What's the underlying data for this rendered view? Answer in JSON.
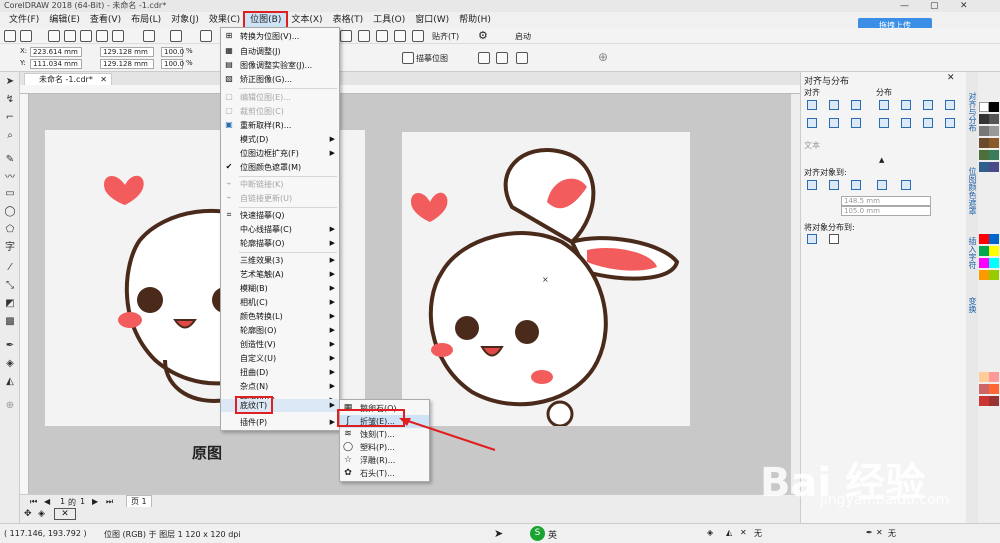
{
  "window": {
    "title": "CorelDRAW 2018 (64-Bit) - 未命名 -1.cdr*"
  },
  "menubar": [
    "文件(F)",
    "编辑(E)",
    "查看(V)",
    "布局(L)",
    "对象(J)",
    "效果(C)",
    "位图(B)",
    "文本(X)",
    "表格(T)",
    "工具(O)",
    "窗口(W)",
    "帮助(H)"
  ],
  "upload_button": "拖拽上传",
  "toolbar": {
    "snap": "贴齐(T)",
    "launch": "启动",
    "trace": "描摹位图",
    "zoom": "100%"
  },
  "propbar": {
    "x": "223.614 mm",
    "y": "111.034 mm",
    "w": "129.128 mm",
    "h": "129.128 mm",
    "sx": "100.0",
    "sy": "100.0",
    "pct": "%"
  },
  "doc_tab": "未命名 -1.cdr*",
  "bitmap_menu": [
    {
      "label": "转换为位图(V)...",
      "disabled": false,
      "icon": "⊞"
    },
    {
      "label": "自动调整(J)",
      "disabled": false,
      "icon": "▦"
    },
    {
      "label": "图像调整实验室(J)...",
      "disabled": false,
      "icon": "▤"
    },
    {
      "label": "矫正图像(G)...",
      "disabled": false,
      "icon": "▧"
    },
    {
      "sep": true
    },
    {
      "label": "编辑位图(E)...",
      "disabled": true,
      "icon": "▢"
    },
    {
      "label": "裁剪位图(C)",
      "disabled": true,
      "icon": "▢"
    },
    {
      "label": "重新取样(R)...",
      "disabled": false,
      "icon": "▣"
    },
    {
      "label": "模式(D)",
      "disabled": false,
      "sub": true
    },
    {
      "label": "位图边框扩充(F)",
      "disabled": false,
      "sub": true
    },
    {
      "label": "位图颜色遮罩(M)",
      "disabled": false,
      "icon": "✔"
    },
    {
      "sep": true
    },
    {
      "label": "中断链接(K)",
      "disabled": true,
      "icon": "⌁"
    },
    {
      "label": "自链接更新(U)",
      "disabled": true,
      "icon": "⌁"
    },
    {
      "sep": true
    },
    {
      "label": "快速描摹(Q)",
      "disabled": false,
      "icon": "⌗"
    },
    {
      "label": "中心线描摹(C)",
      "disabled": false,
      "sub": true
    },
    {
      "label": "轮廓描摹(O)",
      "disabled": false,
      "sub": true
    },
    {
      "sep": true
    },
    {
      "label": "三维效果(3)",
      "disabled": false,
      "sub": true
    },
    {
      "label": "艺术笔触(A)",
      "disabled": false,
      "sub": true
    },
    {
      "label": "模糊(B)",
      "disabled": false,
      "sub": true
    },
    {
      "label": "相机(C)",
      "disabled": false,
      "sub": true
    },
    {
      "label": "颜色转换(L)",
      "disabled": false,
      "sub": true
    },
    {
      "label": "轮廓图(O)",
      "disabled": false,
      "sub": true
    },
    {
      "label": "创造性(V)",
      "disabled": false,
      "sub": true
    },
    {
      "label": "自定义(U)",
      "disabled": false,
      "sub": true
    },
    {
      "label": "扭曲(D)",
      "disabled": false,
      "sub": true
    },
    {
      "label": "杂点(N)",
      "disabled": false,
      "sub": true
    },
    {
      "label": "鲜明化(S)",
      "disabled": false,
      "sub": true
    },
    {
      "label": "底纹(T)",
      "disabled": false,
      "sub": true,
      "highlight": true
    },
    {
      "label": "插件(P)",
      "disabled": false,
      "sub": true
    }
  ],
  "texture_submenu": [
    {
      "label": "鹅卵石(O)...",
      "icon": "▦"
    },
    {
      "label": "折皱(E)...",
      "icon": "ʃ",
      "highlight": true
    },
    {
      "label": "蚀刻(T)...",
      "icon": "≋"
    },
    {
      "label": "塑料(P)...",
      "icon": "◯"
    },
    {
      "label": "浮雕(R)...",
      "icon": "☆"
    },
    {
      "label": "石头(T)...",
      "icon": "✿"
    }
  ],
  "canvas_label": "原图",
  "right_panel": {
    "title": "对齐与分布",
    "align": "对齐",
    "distribute": "分布",
    "text": "文本",
    "align_to": "对齐对象到:",
    "coord1": "148.5 mm",
    "coord2": "105.0 mm",
    "distribute_to": "将对象分布到:"
  },
  "docker_tabs": [
    "对齐与分布",
    "位图颜色遮罩",
    "插入字符",
    "变换"
  ],
  "page_nav": {
    "current": "1",
    "of": "的",
    "total": "1",
    "page_tab": "页 1"
  },
  "status": {
    "coords": "( 117.146, 193.792 )",
    "info": "位图 (RGB) 于 图层 1 120 x 120 dpi",
    "ime": "英",
    "fill_none": "无",
    "outline_none": "无"
  },
  "watermark": {
    "brand": "Bai 经验",
    "url": "jingyan.baidu.com"
  },
  "colors": {
    "accent": "#3a8ee6",
    "highlight_red": "#e02020",
    "rabbit_pink": "#f25c5c",
    "heart": "#f25c5c"
  }
}
